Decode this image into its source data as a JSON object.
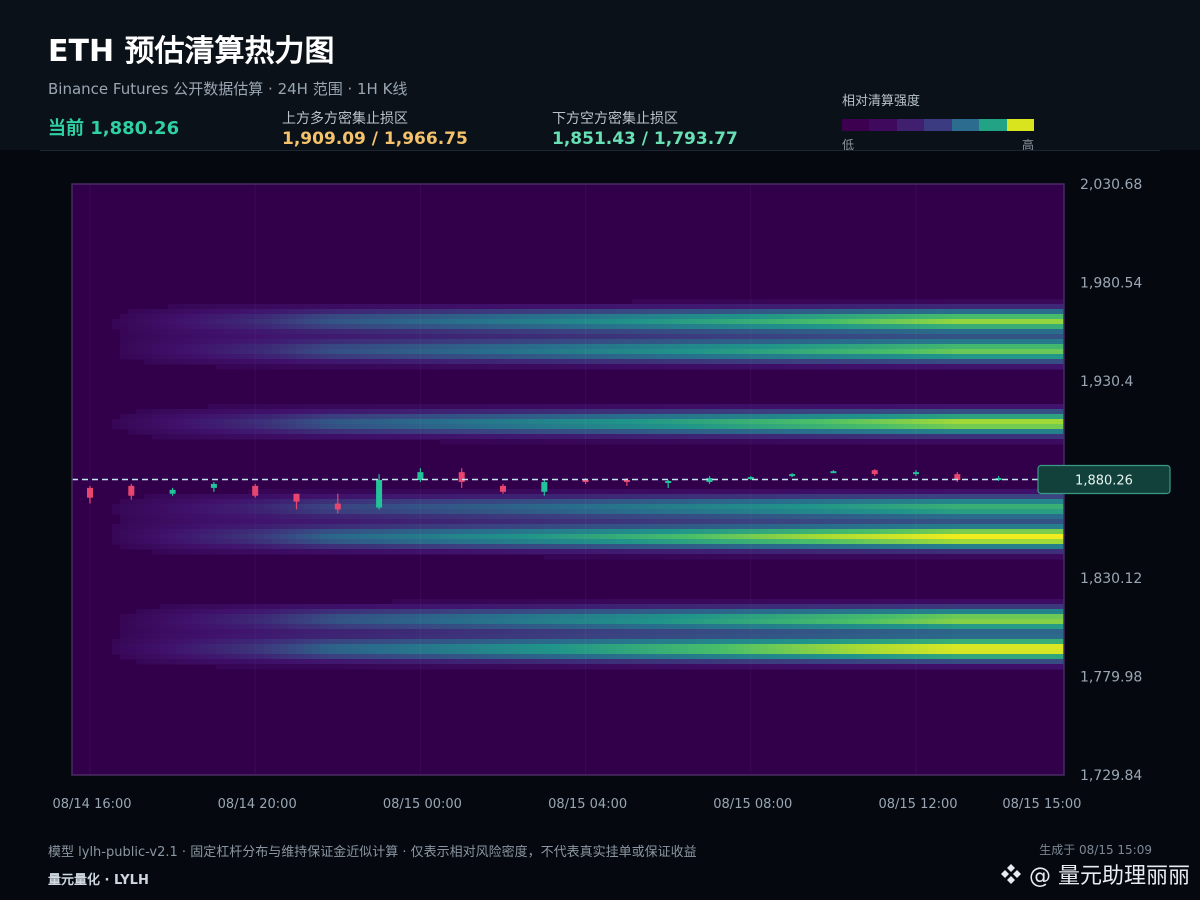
{
  "header": {
    "title": "ETH 预估清算热力图",
    "subtitle": "Binance Futures 公开数据估算 · 24H 范围 · 1H K线",
    "current_text": "当前 1,880.26",
    "upper_label": "上方多方密集止损区",
    "upper_value": "1,909.09 / 1,966.75",
    "lower_label": "下方空方密集止损区",
    "lower_value": "1,851.43 / 1,793.77"
  },
  "legend": {
    "label": "相对清算强度",
    "low": "低",
    "high": "高",
    "colors": [
      "#3d0050",
      "#3f0a5e",
      "#40206e",
      "#3b3b82",
      "#2c6c8e",
      "#22a386",
      "#d9e41e"
    ]
  },
  "footer": {
    "note": "模型 lylh-public-v2.1 · 固定杠杆分布与维持保证金近似计算 · 仅表示相对风险密度，不代表真实挂单或保证收益",
    "brand": "量元量化 · LYLH",
    "generated": "生成于 08/15 15:09",
    "watermark": "@ 量元助理丽丽"
  },
  "chart_data": {
    "type": "heatmap",
    "title": "ETH 预估清算热力图",
    "y_ticks": [
      "2,030.68",
      "1,980.54",
      "1,930.4",
      "1,880.26",
      "1,830.12",
      "1,779.98",
      "1,729.84"
    ],
    "y_tick_values": [
      2030.68,
      1980.54,
      1930.4,
      1880.26,
      1830.12,
      1779.98,
      1729.84
    ],
    "ylim": [
      1729.84,
      2030.68
    ],
    "x_ticks": [
      "08/14 16:00",
      "08/14 20:00",
      "08/15 00:00",
      "08/15 04:00",
      "08/15 08:00",
      "08/15 12:00",
      "08/15 15:00"
    ],
    "x_tick_hours": [
      0,
      4,
      8,
      12,
      16,
      20,
      23
    ],
    "current_price": 1880.26,
    "current_label": "1,880.26",
    "bands": [
      {
        "center": 1961,
        "start_hour": 0.4,
        "peak": 0.85
      },
      {
        "center": 1946,
        "start_hour": 0.4,
        "peak": 0.8
      },
      {
        "center": 1909,
        "start_hour": 0.4,
        "peak": 0.88
      },
      {
        "center": 1866,
        "start_hour": 0.2,
        "peak": 0.7
      },
      {
        "center": 1851,
        "start_hour": 0.4,
        "peak": 1.0
      },
      {
        "center": 1809,
        "start_hour": 0.6,
        "peak": 0.85
      },
      {
        "center": 1794,
        "start_hour": 0.4,
        "peak": 1.0
      }
    ],
    "candles": [
      {
        "o": 1876,
        "c": 1871,
        "h": 1877,
        "l": 1868
      },
      {
        "o": 1877,
        "c": 1872,
        "h": 1878,
        "l": 1870
      },
      {
        "o": 1873,
        "c": 1875,
        "h": 1876,
        "l": 1872
      },
      {
        "o": 1876,
        "c": 1878,
        "h": 1879,
        "l": 1874
      },
      {
        "o": 1877,
        "c": 1872,
        "h": 1878,
        "l": 1871
      },
      {
        "o": 1873,
        "c": 1869,
        "h": 1873,
        "l": 1865
      },
      {
        "o": 1868,
        "c": 1865,
        "h": 1873,
        "l": 1863
      },
      {
        "o": 1866,
        "c": 1880,
        "h": 1883,
        "l": 1865
      },
      {
        "o": 1880,
        "c": 1884,
        "h": 1886,
        "l": 1879
      },
      {
        "o": 1884,
        "c": 1879,
        "h": 1886,
        "l": 1876
      },
      {
        "o": 1877,
        "c": 1874,
        "h": 1878,
        "l": 1873
      },
      {
        "o": 1874,
        "c": 1879,
        "h": 1880,
        "l": 1872
      },
      {
        "o": 1880,
        "c": 1879,
        "h": 1881,
        "l": 1878
      },
      {
        "o": 1880,
        "c": 1879,
        "h": 1881,
        "l": 1877
      },
      {
        "o": 1879,
        "c": 1879.5,
        "h": 1880,
        "l": 1876
      },
      {
        "o": 1879,
        "c": 1881,
        "h": 1882,
        "l": 1878
      },
      {
        "o": 1881,
        "c": 1881.5,
        "h": 1882,
        "l": 1880
      },
      {
        "o": 1882,
        "c": 1883,
        "h": 1883.5,
        "l": 1881.5
      },
      {
        "o": 1884,
        "c": 1884.5,
        "h": 1885,
        "l": 1883.5
      },
      {
        "o": 1885,
        "c": 1883,
        "h": 1885.5,
        "l": 1882
      },
      {
        "o": 1883,
        "c": 1884,
        "h": 1885,
        "l": 1882
      },
      {
        "o": 1883,
        "c": 1880,
        "h": 1884,
        "l": 1879
      },
      {
        "o": 1880,
        "c": 1881,
        "h": 1882,
        "l": 1879.5
      }
    ]
  }
}
